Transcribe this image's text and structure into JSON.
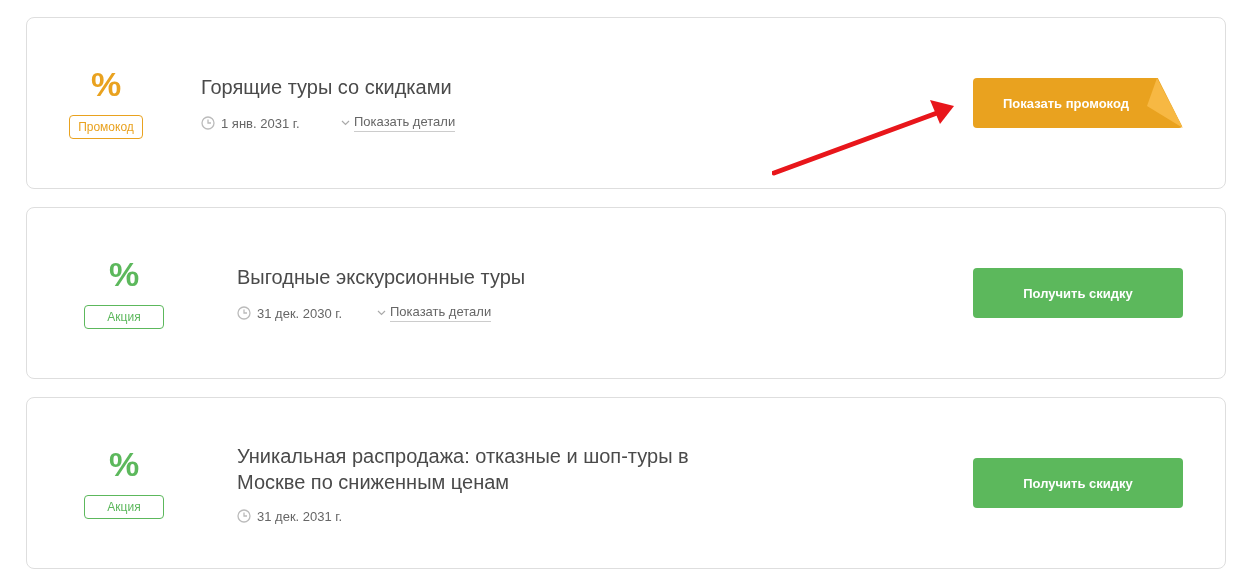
{
  "offers": [
    {
      "kind": "promo",
      "symbol": "%",
      "tag": "Промокод",
      "title": "Горящие туры со скидками",
      "date": "1 янв. 2031 г.",
      "details": "Показать детали",
      "button": "Показать промокод",
      "arrow": true
    },
    {
      "kind": "deal",
      "symbol": "%",
      "tag": "Акция",
      "title": "Выгодные экскурсионные туры",
      "date": "31 дек. 2030 г.",
      "details": "Показать детали",
      "button": "Получить скидку",
      "arrow": false
    },
    {
      "kind": "deal",
      "symbol": "%",
      "tag": "Акция",
      "title": "Уникальная распродажа: отказные и шоп-туры в Москве по сниженным ценам",
      "date": "31 дек. 2031 г.",
      "button": "Получить скидку",
      "arrow": false
    }
  ]
}
